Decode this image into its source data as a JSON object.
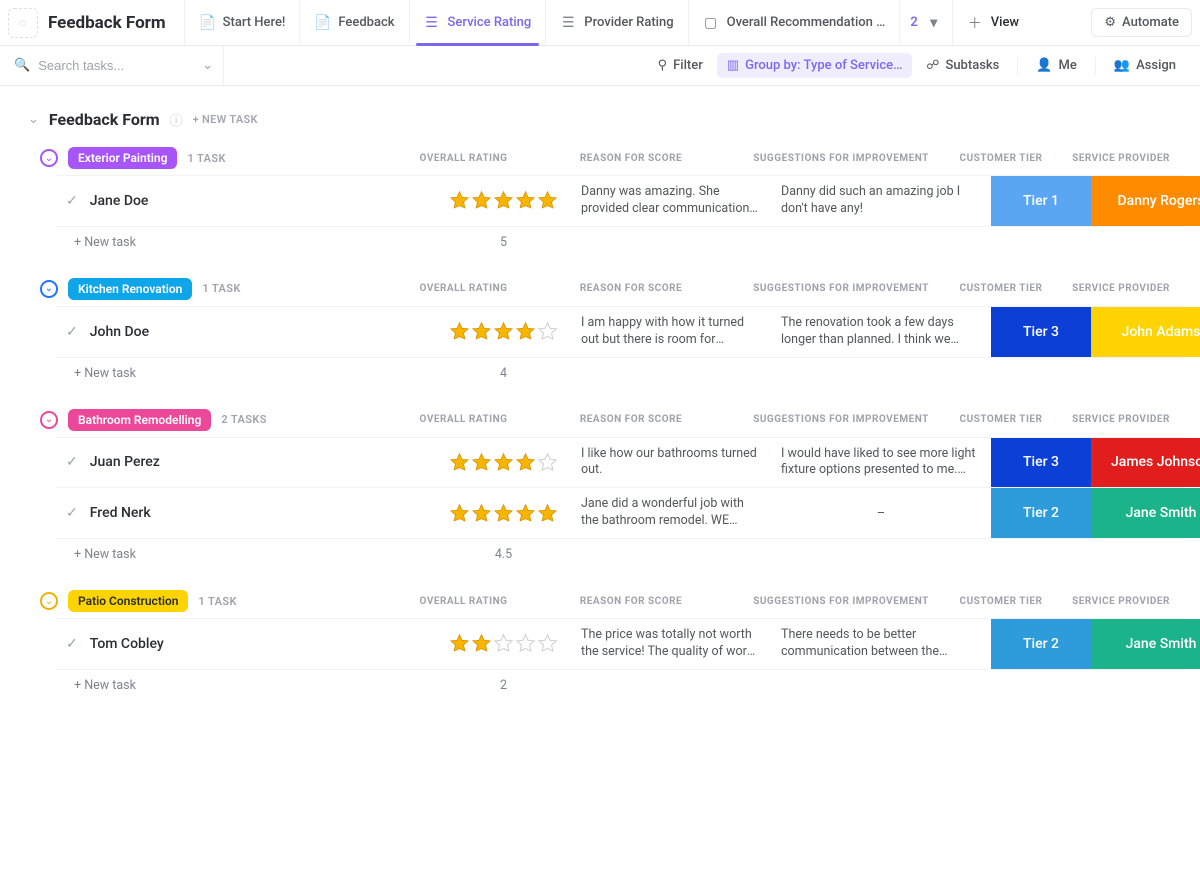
{
  "app": {
    "title": "Feedback Form"
  },
  "tabs": [
    {
      "label": "Start Here!"
    },
    {
      "label": "Feedback"
    },
    {
      "label": "Service Rating",
      "active": true
    },
    {
      "label": "Provider Rating"
    },
    {
      "label": "Overall Recommendation …"
    }
  ],
  "tabs_more_count": "2",
  "add_view_label": "View",
  "automate_label": "Automate",
  "search": {
    "placeholder": "Search tasks..."
  },
  "toolbar": {
    "filter": "Filter",
    "group_by": "Group by: Type of Service…",
    "subtasks": "Subtasks",
    "me": "Me",
    "assignee": "Assign"
  },
  "board": {
    "title": "Feedback Form",
    "new_task_hdr": "+ NEW TASK"
  },
  "columns": {
    "rating": "OVERALL RATING",
    "reason": "REASON FOR SCORE",
    "suggest": "SUGGESTIONS FOR IMPROVEMENT",
    "tier": "CUSTOMER TIER",
    "provider": "SERVICE PROVIDER"
  },
  "new_task_label": "+ New task",
  "groups": [
    {
      "id": "exterior",
      "chip": "Exterior Painting",
      "chip_bg": "#a855f7",
      "circle_cls": "clr-purple-border",
      "count": "1 TASK",
      "footer_avg": "5",
      "rows": [
        {
          "name": "Jane Doe",
          "stars": 5,
          "reason": "Danny was amazing. She provided clear communication of time…",
          "suggest": "Danny did such an amazing job I don't have any!",
          "tier": {
            "label": "Tier 1",
            "bg": "#5aa6f2"
          },
          "provider": {
            "label": "Danny Rogers",
            "bg": "#ff8c00"
          }
        }
      ]
    },
    {
      "id": "kitchen",
      "chip": "Kitchen Renovation",
      "chip_bg": "#0ea5e9",
      "circle_cls": "clr-blue-border",
      "count": "1 TASK",
      "footer_avg": "4",
      "rows": [
        {
          "name": "John Doe",
          "stars": 4,
          "reason": "I am happy with how it turned out but there is room for improvement",
          "suggest": "The renovation took a few days longer than planned. I think we could have finished on …",
          "tier": {
            "label": "Tier 3",
            "bg": "#0b3fd6"
          },
          "provider": {
            "label": "John Adams",
            "bg": "#fdd401"
          }
        }
      ]
    },
    {
      "id": "bathroom",
      "chip": "Bathroom Remodelling",
      "chip_bg": "#ec4899",
      "circle_cls": "clr-pink-border",
      "count": "2 TASKS",
      "footer_avg": "4.5",
      "rows": [
        {
          "name": "Juan Perez",
          "stars": 4,
          "reason": "I like how our bathrooms turned out.",
          "suggest": "I would have liked to see more light fixture options presented to me. The options provided…",
          "tier": {
            "label": "Tier 3",
            "bg": "#0b3fd6"
          },
          "provider": {
            "label": "James Johnson",
            "bg": "#e11d1d"
          }
        },
        {
          "name": "Fred Nerk",
          "stars": 5,
          "reason": "Jane did a wonderful job with the bathroom remodel. WE LOVE IT!",
          "suggest": "–",
          "tier": {
            "label": "Tier 2",
            "bg": "#2e9cdb"
          },
          "provider": {
            "label": "Jane Smith",
            "bg": "#1bb38a"
          }
        }
      ]
    },
    {
      "id": "patio",
      "chip": "Patio Construction",
      "chip_bg": "#fdd401",
      "chip_fg": "#2a2e34",
      "circle_cls": "clr-yellow-border",
      "count": "1 TASK",
      "footer_avg": "2",
      "rows": [
        {
          "name": "Tom Cobley",
          "stars": 2,
          "reason": "The price was totally not worth the service! The quality of work …",
          "suggest": "There needs to be better communication between the designer and the people doing the…",
          "tier": {
            "label": "Tier 2",
            "bg": "#2e9cdb"
          },
          "provider": {
            "label": "Jane Smith",
            "bg": "#1bb38a"
          }
        }
      ]
    }
  ]
}
